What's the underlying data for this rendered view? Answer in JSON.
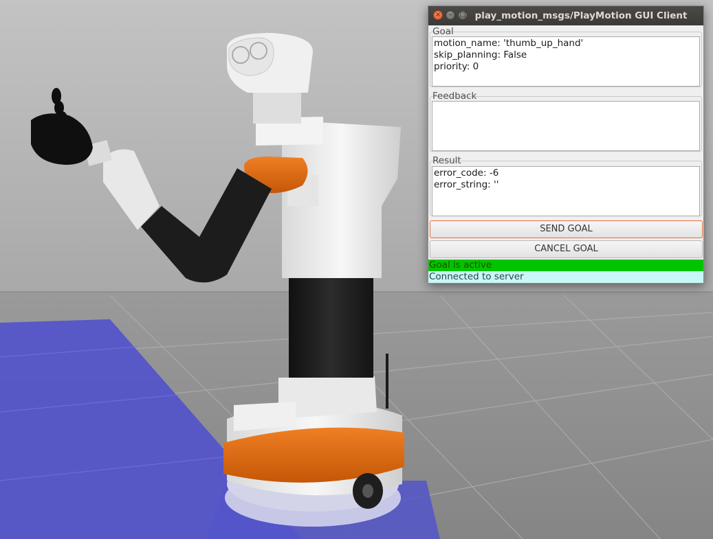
{
  "window": {
    "title": "play_motion_msgs/PlayMotion GUI Client",
    "close_glyph": "×",
    "min_glyph": "–",
    "max_glyph": "□"
  },
  "goal": {
    "label": "Goal",
    "lines": [
      "motion_name: 'thumb_up_hand'",
      "skip_planning: False",
      "priority: 0"
    ]
  },
  "feedback": {
    "label": "Feedback",
    "lines": []
  },
  "result": {
    "label": "Result",
    "lines": [
      "error_code: -6",
      "error_string: ''"
    ]
  },
  "buttons": {
    "send_goal": "SEND GOAL",
    "cancel_goal": "CANCEL GOAL"
  },
  "status": {
    "goal_state": "Goal is active",
    "goal_state_color": "#00c400",
    "connection": "Connected to server",
    "connection_color": "#c8f7f7"
  },
  "colors": {
    "sky": "#b9b9b9",
    "ground": "#8c8c8c",
    "floor_highlight": "#5455c9",
    "robot_white": "#efefef",
    "robot_black": "#1f1f1f",
    "robot_orange": "#e06a10"
  },
  "icons": [
    "close-icon",
    "minimize-icon",
    "maximize-icon"
  ]
}
